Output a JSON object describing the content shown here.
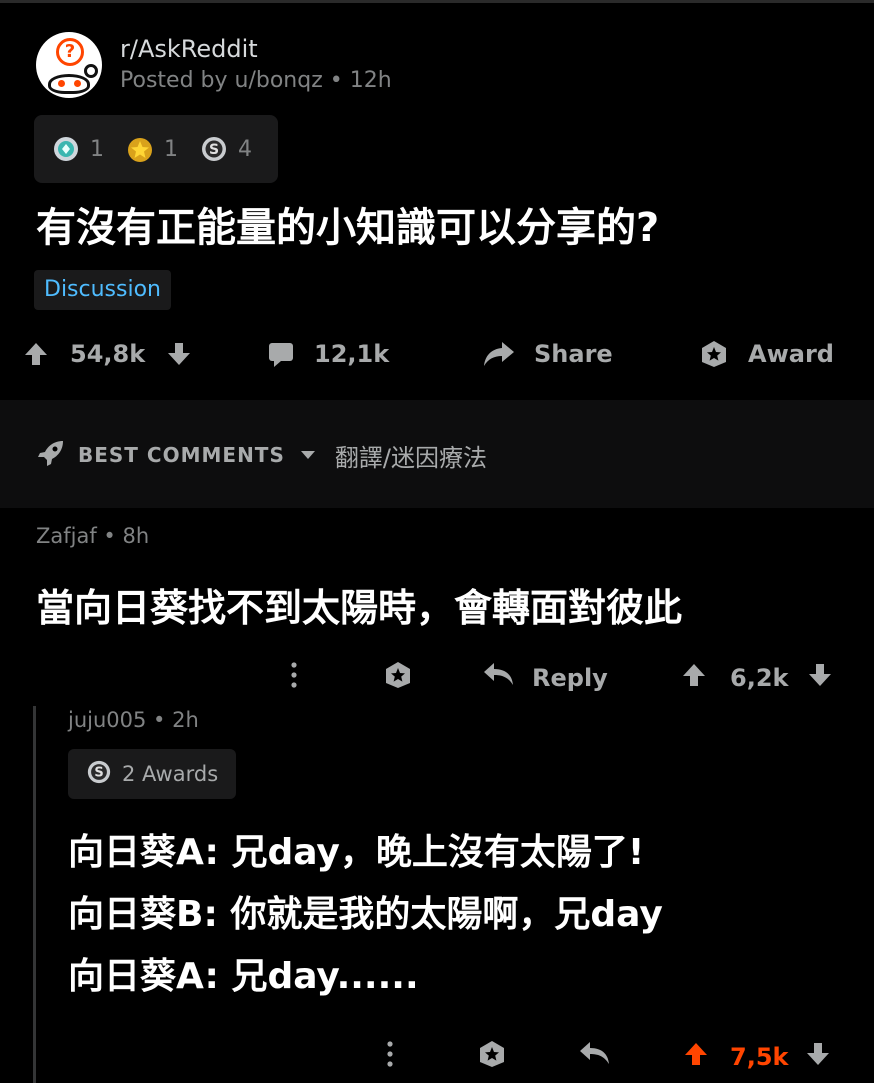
{
  "post": {
    "subreddit": "r/AskReddit",
    "posted_by": "Posted by u/bonqz • 12h",
    "awards": [
      {
        "icon": "gem-award-icon",
        "count": "1"
      },
      {
        "icon": "gold-star-award-icon",
        "count": "1"
      },
      {
        "icon": "silver-award-icon",
        "count": "4"
      }
    ],
    "title": "有沒有正能量的小知識可以分享的?",
    "flair": "Discussion",
    "votes": "54,8k",
    "comments": "12,1k",
    "share_label": "Share",
    "award_label": "Award"
  },
  "sort": {
    "label": "BEST COMMENTS",
    "extra": "翻譯/迷因療法"
  },
  "comment": {
    "author_meta": "Zafjaf • 8h",
    "body": "當向日葵找不到太陽時，會轉面對彼此",
    "reply_label": "Reply",
    "votes": "6,2k"
  },
  "reply": {
    "author_meta": "juju005 • 2h",
    "awards_label": "2 Awards",
    "lines": [
      "向日葵A: 兄day，晚上沒有太陽了!",
      "向日葵B: 你就是我的太陽啊，兄day",
      "向日葵A: 兄day......"
    ],
    "votes": "7,5k"
  },
  "colors": {
    "background": "#000000",
    "text": "#ffffff",
    "muted": "#818384",
    "flair": "#4fbcff",
    "upvote_active": "#ff4500"
  }
}
